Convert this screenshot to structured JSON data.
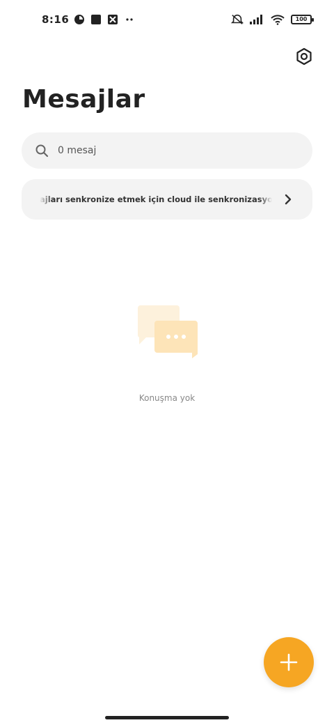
{
  "status_bar": {
    "time": "8:16",
    "battery": "100",
    "icons_left": [
      "data-saver-icon",
      "square-app-icon",
      "mail-icon",
      "more-notifications-icon"
    ],
    "icons_right": [
      "mute-icon",
      "signal-icon",
      "wifi-icon",
      "battery-icon"
    ]
  },
  "header": {
    "title": "Mesajlar",
    "settings_icon": "settings-hex-icon"
  },
  "search": {
    "placeholder": "0 mesaj"
  },
  "sync_banner": {
    "text": "ajları senkronize etmek için cloud ile senkronizasyon özelliğini açın"
  },
  "empty_state": {
    "text": "Konuşma yok"
  },
  "fab": {
    "icon": "plus-icon"
  },
  "colors": {
    "accent": "#f6a623",
    "surface": "#f3f3f3",
    "empty_illustration": "#fde9c4"
  }
}
